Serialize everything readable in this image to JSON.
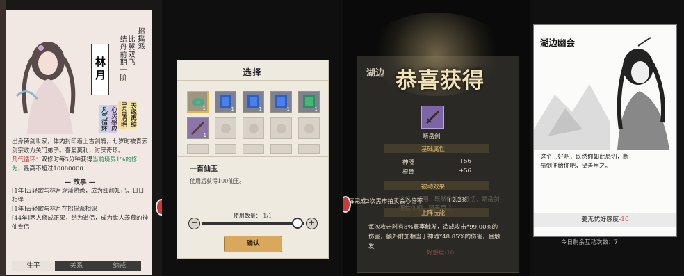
{
  "panel1": {
    "name": "林月",
    "sect": "招摇派",
    "cultivation": "结丹前期一阶",
    "title": "比翼双飞",
    "tags": [
      "天缘再续",
      "灵台清明",
      "心灵感应",
      "凡气循环"
    ],
    "bio_main": "出身铸剑世家，体内封印着上古剑魄，七岁时被青云剑宗收为关门弟子。喜爱莫利，讨厌奇珍。",
    "bio_effect_label": "凡气循环：",
    "bio_effect_text": "双修时每5分钟获得",
    "bio_effect_green": "当前境界1%的修为",
    "bio_effect_tail": "，最高不超过10000000",
    "story_title": "故事",
    "story": [
      "[1年]云轻歌与林月逐渐熟悉，成为红颜知己，日日相伴",
      "[1年]云轻歌与林月在招摇派相识",
      "[44年]两人修成正果，结为道侣，成为世人羡慕的神仙眷侣"
    ],
    "tabs": [
      "生平",
      "关系",
      "纳戒"
    ]
  },
  "panel2": {
    "title": "选择",
    "slot_count": "1",
    "item_name": "一百仙玉",
    "item_desc": "使用后获得100仙玉。",
    "qty_label": "使用数量：",
    "qty_value": "1/1",
    "confirm": "确认",
    "minus": "−",
    "plus": "+"
  },
  "panel3": {
    "bg_title": "湖边",
    "congrats": "恭喜获得",
    "item_name": "断岳剑",
    "basic_attr": "基础属性",
    "attr1_name": "神魂",
    "attr1_val": "+56",
    "attr2_name": "根骨",
    "attr2_val": "+56",
    "passive": "被动效果",
    "passive_text": "每完成2次黑市拍卖会心倍率",
    "passive_val": "+2.2%",
    "skill": "上阵技能",
    "skill_text": "每次攻击时有8%概率触发，造成攻击*99.00%的伤害，额外附加相当于神魂*48.85%的伤害，且触发",
    "bg_text": "这位…好吧，既然你如此恳切，断岳剑便给你吧，望善用之。",
    "bg_foot": "好感度-10"
  },
  "panel4": {
    "title": "湖边幽会",
    "text": "这个…好吧，既然你如此恳切，断岳剑便给你吧，望善用之。",
    "foot_label": "姜无忧好感度",
    "foot_val": "-10",
    "remain": "今日剩余互动次数：7"
  }
}
